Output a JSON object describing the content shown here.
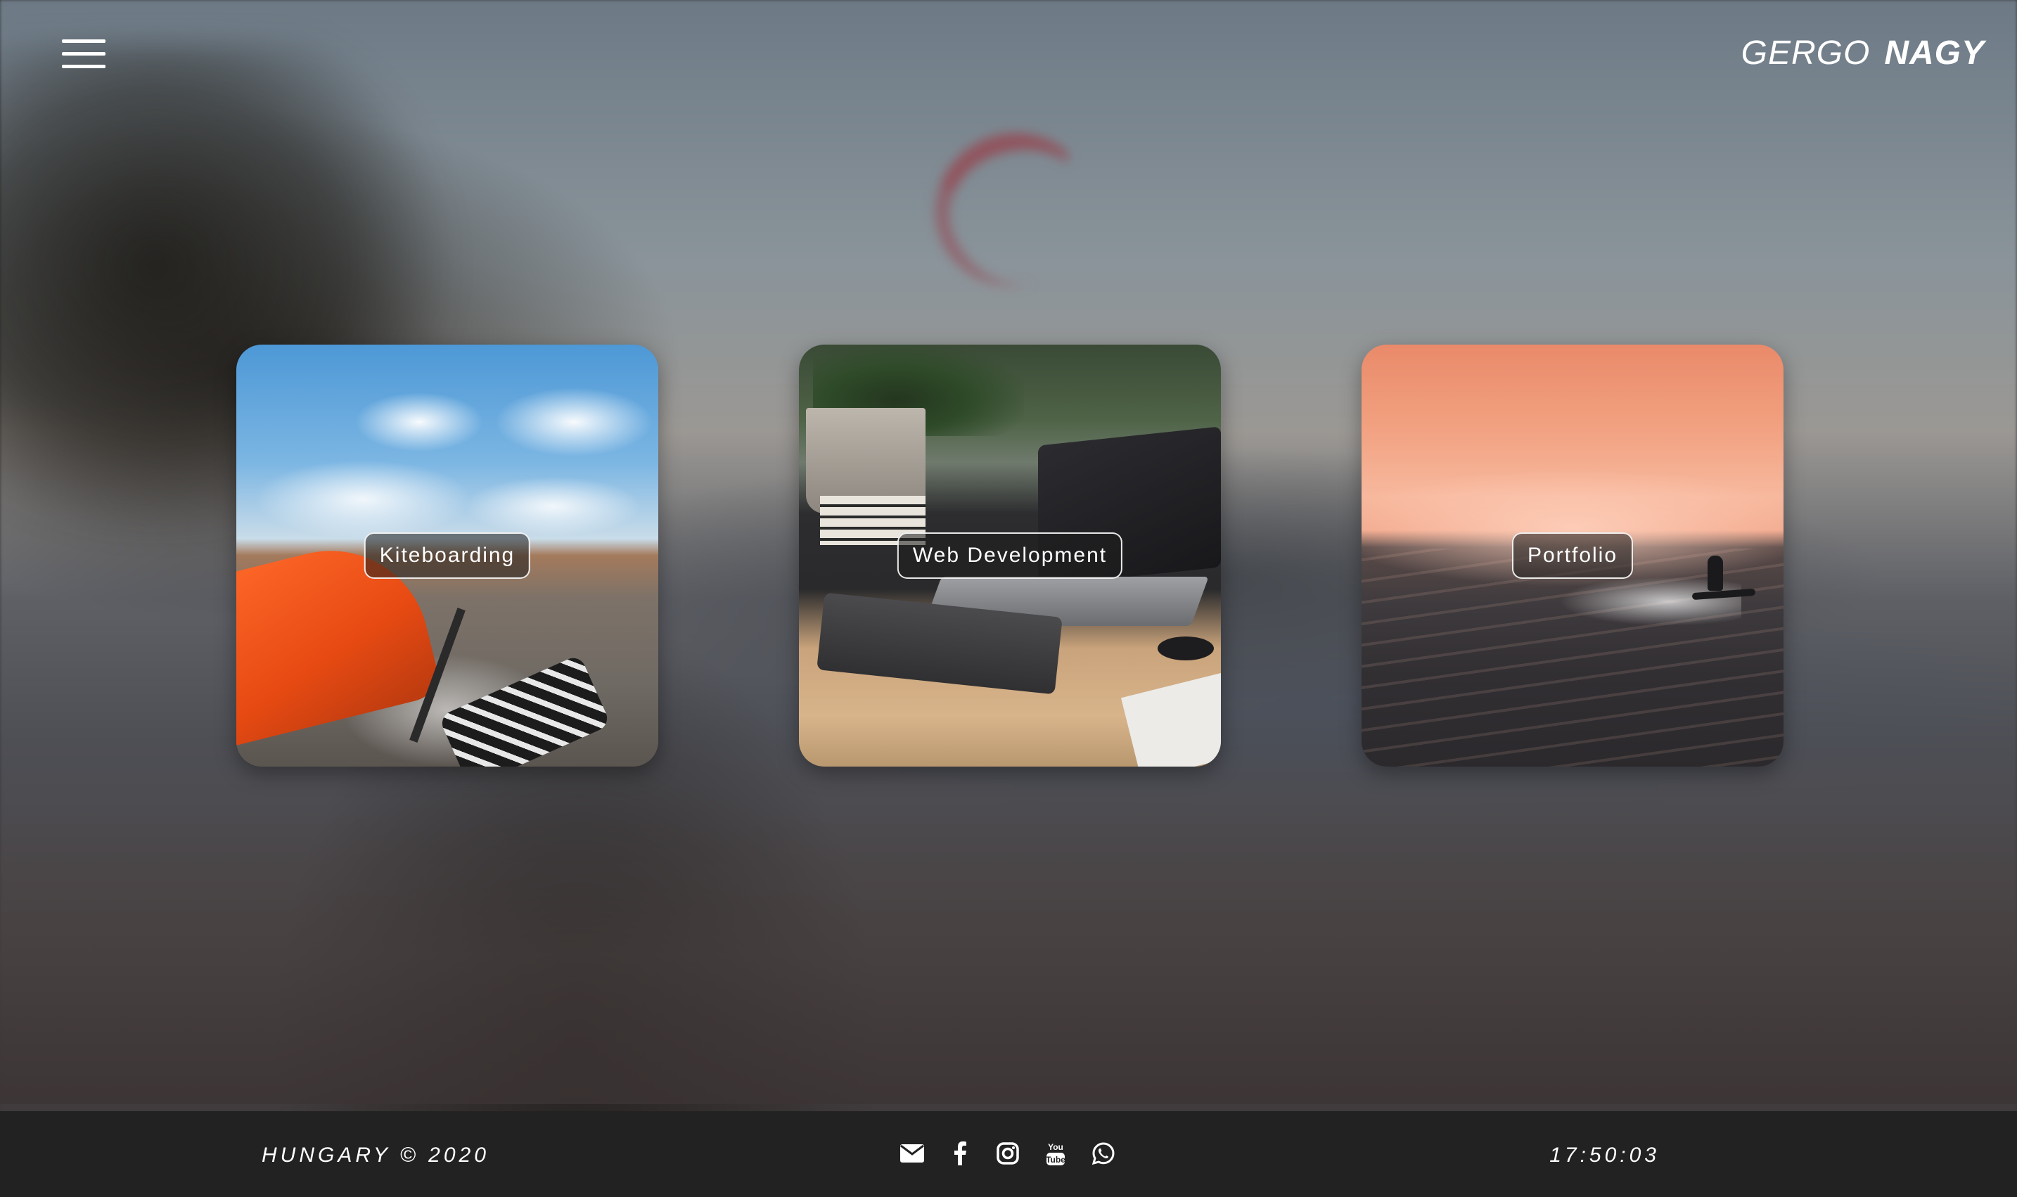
{
  "header": {
    "brand_first": "GERGO",
    "brand_last": "NAGY",
    "menu_icon": "hamburger-menu-icon"
  },
  "cards": [
    {
      "label": "Kiteboarding",
      "image": "kiteboarding-photo"
    },
    {
      "label": "Web Development",
      "image": "desk-laptop-photo"
    },
    {
      "label": "Portfolio",
      "image": "sunset-kitesurf-photo"
    }
  ],
  "footer": {
    "left_text": "HUNGARY © 2020",
    "time": "17:50:03",
    "social_icons": [
      "email-icon",
      "facebook-icon",
      "instagram-icon",
      "youtube-icon",
      "whatsapp-icon"
    ]
  },
  "colors": {
    "footer_bg": "#232223",
    "text": "#ffffff",
    "label_bg": "rgba(30,30,30,0.55)"
  }
}
